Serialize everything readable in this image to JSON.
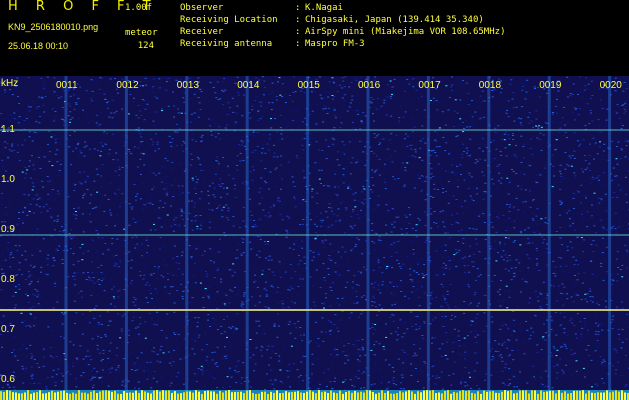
{
  "header": {
    "app_title": "H R O F F T",
    "version": "1.00f",
    "filename": "KN9_2506180010.png",
    "meteor_label": "meteor",
    "timestamp": "25.06.18 00:10",
    "meteor_count": "124"
  },
  "info": [
    {
      "label": "Observer",
      "value": "K.Nagai"
    },
    {
      "label": "Receiving Location",
      "value": "Chigasaki, Japan (139.414 35.340)"
    },
    {
      "label": "Receiver",
      "value": "AirSpy mini (Miakejima VOR 108.65MHz)"
    },
    {
      "label": "Receiving antenna",
      "value": "Maspro FM-3"
    }
  ],
  "separator": ":",
  "colors": {
    "text": "#ffff40",
    "background": "#101050",
    "signal": "#00d0ff"
  },
  "chart_data": {
    "type": "heatmap",
    "ylabel": "kHz",
    "y_ticks": [
      "1.1",
      "1.0",
      "0.9",
      "0.8",
      "0.7",
      "0.6"
    ],
    "x_ticks": [
      "0011",
      "0012",
      "0013",
      "0014",
      "0015",
      "0016",
      "0017",
      "0018",
      "0019",
      "0020"
    ],
    "horizontal_lines_khz": [
      1.1,
      0.89,
      0.74
    ],
    "grid": true
  }
}
